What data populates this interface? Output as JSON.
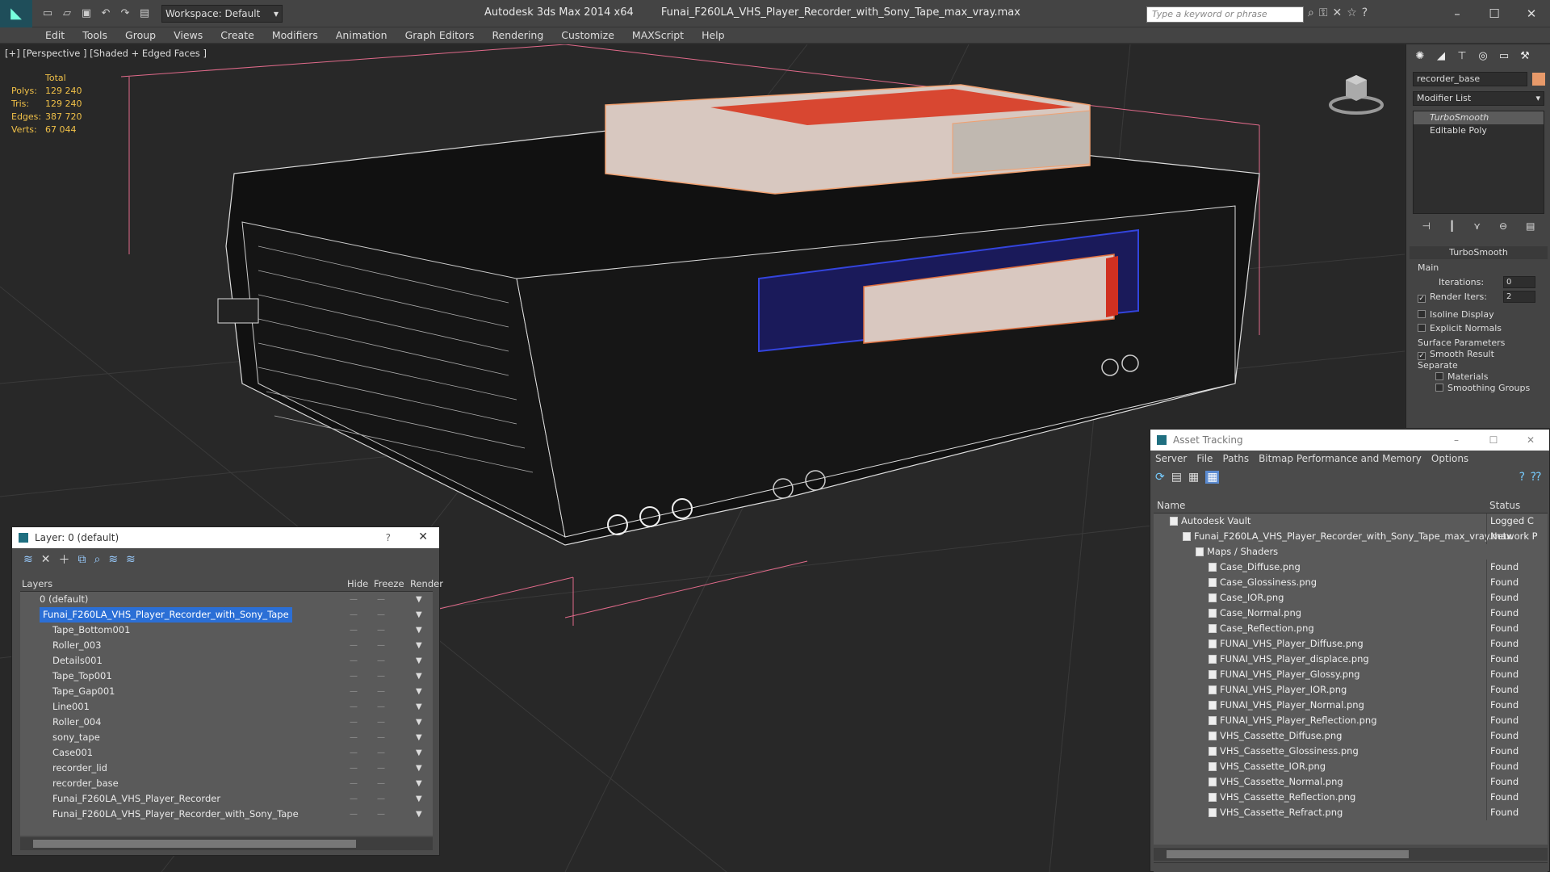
{
  "titlebar": {
    "workspace": "Workspace: Default",
    "app_title": "Autodesk 3ds Max  2014 x64",
    "file_title": "Funai_F260LA_VHS_Player_Recorder_with_Sony_Tape_max_vray.max",
    "search_placeholder": "Type a keyword or phrase"
  },
  "menu": [
    "Edit",
    "Tools",
    "Group",
    "Views",
    "Create",
    "Modifiers",
    "Animation",
    "Graph Editors",
    "Rendering",
    "Customize",
    "MAXScript",
    "Help"
  ],
  "viewport": {
    "label": "[+] [Perspective ] [Shaded + Edged Faces ]",
    "stats": {
      "header": "Total",
      "polys_label": "Polys:",
      "polys": "129 240",
      "tris_label": "Tris:",
      "tris": "129 240",
      "edges_label": "Edges:",
      "edges": "387 720",
      "verts_label": "Verts:",
      "verts": "67 044"
    }
  },
  "command_panel": {
    "object_name": "recorder_base",
    "modifier_list": "Modifier List",
    "stack": [
      "TurboSmooth",
      "Editable Poly"
    ],
    "rollout": "TurboSmooth",
    "main": "Main",
    "iterations_label": "Iterations:",
    "iterations": "0",
    "render_iters_label": "Render Iters:",
    "render_iters": "2",
    "isoline": "Isoline Display",
    "explicit": "Explicit Normals",
    "surface": "Surface Parameters",
    "smooth_result": "Smooth Result",
    "separate": "Separate",
    "materials": "Materials",
    "smoothing_groups": "Smoothing Groups"
  },
  "layer_dialog": {
    "title": "Layer: 0 (default)",
    "help": "?",
    "col_layers": "Layers",
    "col_hide": "Hide",
    "col_freeze": "Freeze",
    "col_render": "Render",
    "rows": [
      {
        "name": "0 (default)",
        "level": 0
      },
      {
        "name": "Funai_F260LA_VHS_Player_Recorder_with_Sony_Tape",
        "level": 0,
        "selected": true
      },
      {
        "name": "Tape_Bottom001",
        "level": 1
      },
      {
        "name": "Roller_003",
        "level": 1
      },
      {
        "name": "Details001",
        "level": 1
      },
      {
        "name": "Tape_Top001",
        "level": 1
      },
      {
        "name": "Tape_Gap001",
        "level": 1
      },
      {
        "name": "Line001",
        "level": 1
      },
      {
        "name": "Roller_004",
        "level": 1
      },
      {
        "name": "sony_tape",
        "level": 1
      },
      {
        "name": "Case001",
        "level": 1
      },
      {
        "name": "recorder_lid",
        "level": 1
      },
      {
        "name": "recorder_base",
        "level": 1
      },
      {
        "name": "Funai_F260LA_VHS_Player_Recorder",
        "level": 1
      },
      {
        "name": "Funai_F260LA_VHS_Player_Recorder_with_Sony_Tape",
        "level": 1
      }
    ]
  },
  "asset_dialog": {
    "title": "Asset Tracking",
    "menu": [
      "Server",
      "File",
      "Paths",
      "Bitmap Performance and Memory",
      "Options"
    ],
    "col_name": "Name",
    "col_status": "Status",
    "rows": [
      {
        "name": "Autodesk Vault",
        "status": "Logged C",
        "level": 0
      },
      {
        "name": "Funai_F260LA_VHS_Player_Recorder_with_Sony_Tape_max_vray.max",
        "status": "Network P",
        "level": 1
      },
      {
        "name": "Maps / Shaders",
        "status": "",
        "level": 2
      },
      {
        "name": "Case_Diffuse.png",
        "status": "Found",
        "level": 3
      },
      {
        "name": "Case_Glossiness.png",
        "status": "Found",
        "level": 3
      },
      {
        "name": "Case_IOR.png",
        "status": "Found",
        "level": 3
      },
      {
        "name": "Case_Normal.png",
        "status": "Found",
        "level": 3
      },
      {
        "name": "Case_Reflection.png",
        "status": "Found",
        "level": 3
      },
      {
        "name": "FUNAI_VHS_Player_Diffuse.png",
        "status": "Found",
        "level": 3
      },
      {
        "name": "FUNAI_VHS_Player_displace.png",
        "status": "Found",
        "level": 3
      },
      {
        "name": "FUNAI_VHS_Player_Glossy.png",
        "status": "Found",
        "level": 3
      },
      {
        "name": "FUNAI_VHS_Player_IOR.png",
        "status": "Found",
        "level": 3
      },
      {
        "name": "FUNAI_VHS_Player_Normal.png",
        "status": "Found",
        "level": 3
      },
      {
        "name": "FUNAI_VHS_Player_Reflection.png",
        "status": "Found",
        "level": 3
      },
      {
        "name": "VHS_Cassette_Diffuse.png",
        "status": "Found",
        "level": 3
      },
      {
        "name": "VHS_Cassette_Glossiness.png",
        "status": "Found",
        "level": 3
      },
      {
        "name": "VHS_Cassette_IOR.png",
        "status": "Found",
        "level": 3
      },
      {
        "name": "VHS_Cassette_Normal.png",
        "status": "Found",
        "level": 3
      },
      {
        "name": "VHS_Cassette_Reflection.png",
        "status": "Found",
        "level": 3
      },
      {
        "name": "VHS_Cassette_Refract.png",
        "status": "Found",
        "level": 3
      }
    ]
  }
}
